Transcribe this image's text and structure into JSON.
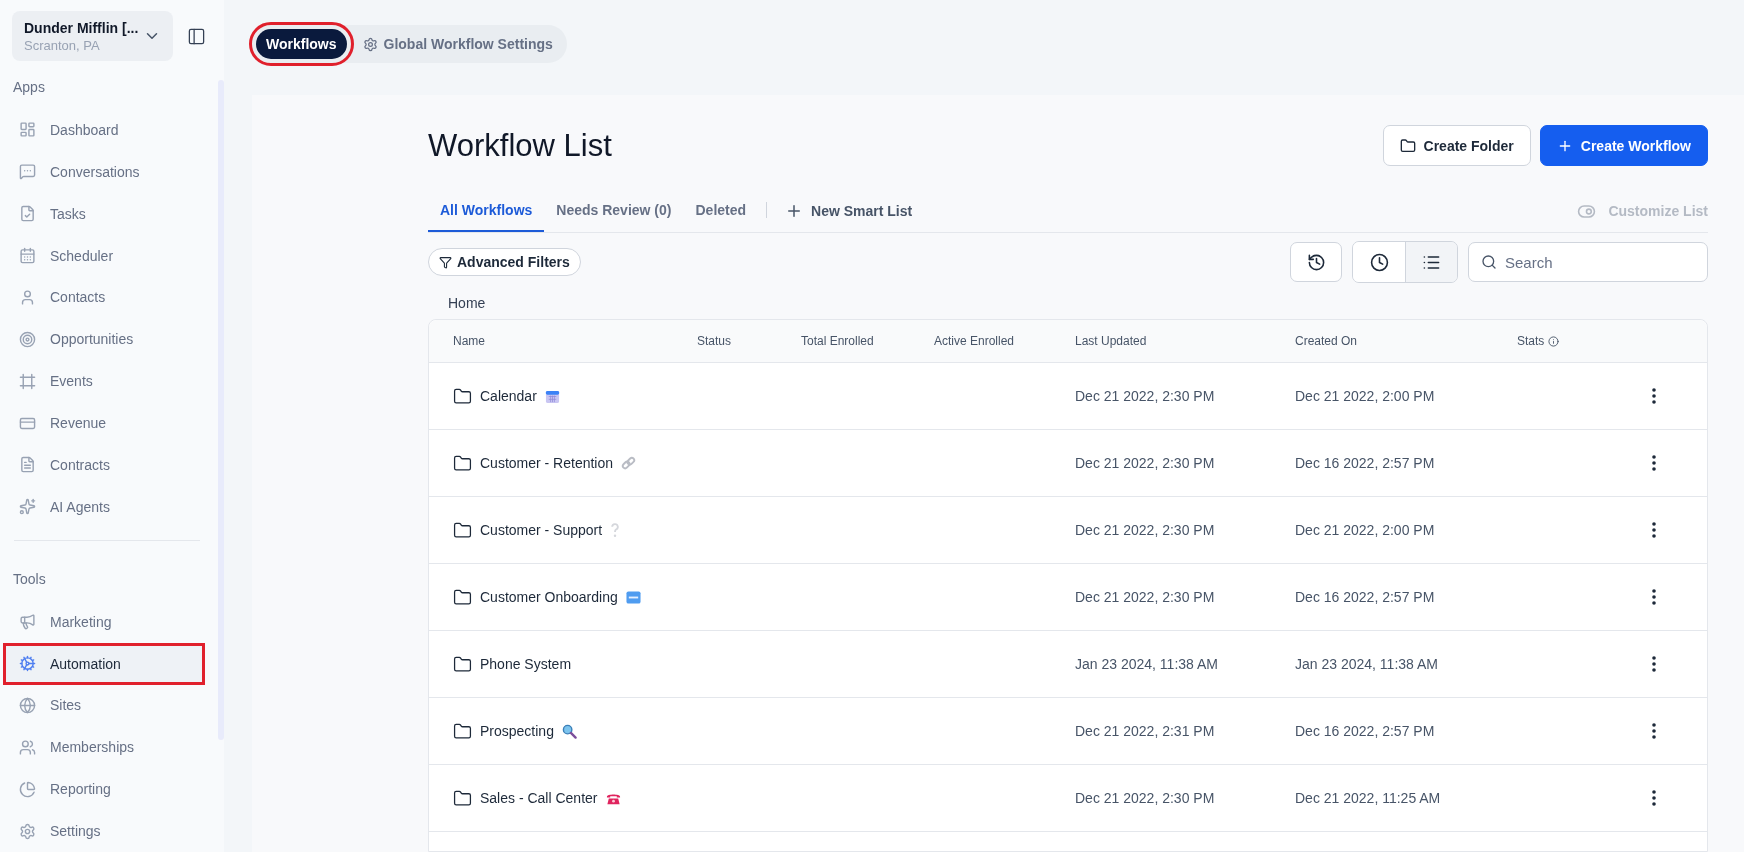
{
  "account": {
    "name": "Dunder Mifflin [...",
    "location": "Scranton, PA"
  },
  "sidebar": {
    "sections": [
      {
        "title": "Apps",
        "items": [
          {
            "label": "Dashboard",
            "selected": false,
            "highlighted": false
          },
          {
            "label": "Conversations",
            "selected": false,
            "highlighted": false
          },
          {
            "label": "Tasks",
            "selected": false,
            "highlighted": false
          },
          {
            "label": "Scheduler",
            "selected": false,
            "highlighted": false
          },
          {
            "label": "Contacts",
            "selected": false,
            "highlighted": false
          },
          {
            "label": "Opportunities",
            "selected": false,
            "highlighted": false
          },
          {
            "label": "Events",
            "selected": false,
            "highlighted": false
          },
          {
            "label": "Revenue",
            "selected": false,
            "highlighted": false
          },
          {
            "label": "Contracts",
            "selected": false,
            "highlighted": false
          },
          {
            "label": "AI Agents",
            "selected": false,
            "highlighted": false
          }
        ]
      },
      {
        "title": "Tools",
        "items": [
          {
            "label": "Marketing",
            "selected": false,
            "highlighted": false
          },
          {
            "label": "Automation",
            "selected": true,
            "highlighted": true
          },
          {
            "label": "Sites",
            "selected": false,
            "highlighted": false
          },
          {
            "label": "Memberships",
            "selected": false,
            "highlighted": false
          },
          {
            "label": "Reporting",
            "selected": false,
            "highlighted": false
          },
          {
            "label": "Settings",
            "selected": false,
            "highlighted": false
          }
        ]
      }
    ]
  },
  "top_tabs": [
    {
      "label": "Workflows",
      "selected": true,
      "highlighted": true
    },
    {
      "label": "Global Workflow Settings",
      "selected": false,
      "highlighted": false
    }
  ],
  "page": {
    "title": "Workflow List",
    "buttons": [
      {
        "label": "Create Folder",
        "kind": "secondary"
      },
      {
        "label": "Create Workflow",
        "kind": "primary"
      }
    ]
  },
  "list_tabs": [
    {
      "label": "All Workflows",
      "selected": true
    },
    {
      "label": "Needs Review (0)",
      "selected": false
    },
    {
      "label": "Deleted",
      "selected": false
    }
  ],
  "new_smart_list": "New Smart List",
  "customize_list": {
    "label": "Customize List",
    "disabled": true
  },
  "filters": {
    "label": "Advanced Filters"
  },
  "view_toggle": [
    {
      "kind": "clock",
      "selected": false
    },
    {
      "kind": "list",
      "selected": true
    }
  ],
  "search": {
    "placeholder": "Search"
  },
  "breadcrumb": "Home",
  "table": {
    "columns": [
      "Name",
      "Status",
      "Total Enrolled",
      "Active Enrolled",
      "Last Updated",
      "Created On",
      "Stats"
    ],
    "rows": [
      {
        "name": "Calendar",
        "kind": "calendar",
        "last_updated": "Dec 21 2022, 2:30 PM",
        "created_on": "Dec 21 2022, 2:00 PM"
      },
      {
        "name": "Customer - Retention",
        "kind": "link",
        "last_updated": "Dec 21 2022, 2:30 PM",
        "created_on": "Dec 16 2022, 2:57 PM"
      },
      {
        "name": "Customer - Support",
        "kind": "question",
        "last_updated": "Dec 21 2022, 2:30 PM",
        "created_on": "Dec 21 2022, 2:00 PM"
      },
      {
        "name": "Customer Onboarding",
        "kind": "new",
        "last_updated": "Dec 21 2022, 2:30 PM",
        "created_on": "Dec 16 2022, 2:57 PM"
      },
      {
        "name": "Phone System",
        "kind": "plain",
        "last_updated": "Jan 23 2024, 11:38 AM",
        "created_on": "Jan 23 2024, 11:38 AM"
      },
      {
        "name": "Prospecting",
        "kind": "magnifier",
        "last_updated": "Dec 21 2022, 2:31 PM",
        "created_on": "Dec 16 2022, 2:57 PM"
      },
      {
        "name": "Sales - Call Center",
        "kind": "phone",
        "last_updated": "Dec 21 2022, 2:30 PM",
        "created_on": "Dec 21 2022, 11:25 AM"
      }
    ]
  }
}
